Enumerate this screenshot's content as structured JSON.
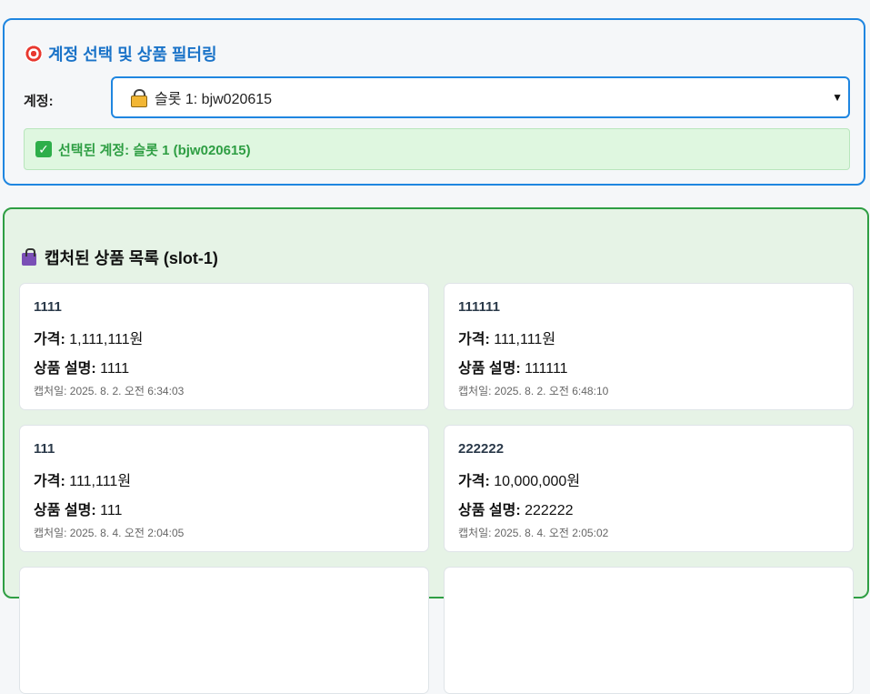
{
  "account_panel": {
    "title": "계정 선택 및 상품 필터링",
    "title_icon": "target-icon",
    "account_label": "계정:",
    "select_value": "슬롯 1: bjw020615",
    "select_icon": "lock-icon",
    "selected_text": "선택된 계정: 슬롯 1 (bjw020615)"
  },
  "products_panel": {
    "title": "캡처된 상품 목록 (slot-1)",
    "title_icon": "shopping-bag-icon",
    "price_label": "가격:",
    "desc_label": "상품 설명:",
    "items": [
      {
        "name": "1111",
        "price": "1,111,111원",
        "desc": "1111",
        "captured": "캡처일: 2025. 8. 2. 오전 6:34:03"
      },
      {
        "name": "111111",
        "price": "111,111원",
        "desc": "111111",
        "captured": "캡처일: 2025. 8. 2. 오전 6:48:10"
      },
      {
        "name": "111",
        "price": "111,111원",
        "desc": "111",
        "captured": "캡처일: 2025. 8. 4. 오전 2:04:05"
      },
      {
        "name": "222222",
        "price": "10,000,000원",
        "desc": "222222",
        "captured": "캡처일: 2025. 8. 4. 오전 2:05:02"
      }
    ]
  },
  "colors": {
    "accent_blue": "#1f86e0",
    "accent_green": "#2e9e43",
    "success_bg": "#dff7e0"
  }
}
